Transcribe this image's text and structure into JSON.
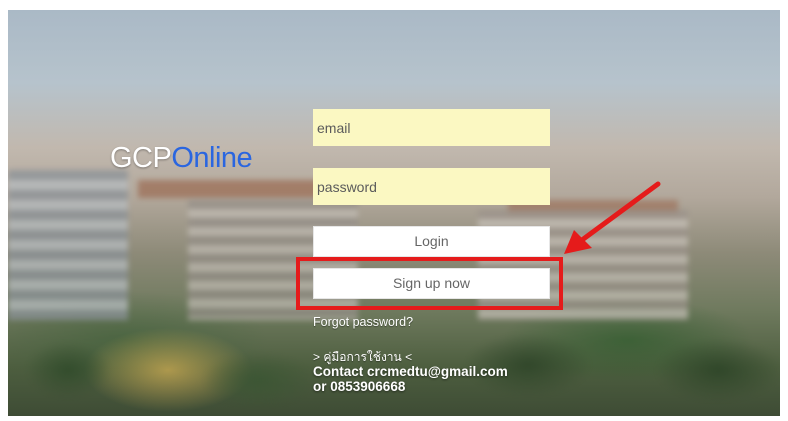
{
  "brand": {
    "part1": "GCP",
    "part2": "Online"
  },
  "login_form": {
    "email_placeholder": "email",
    "password_placeholder": "password",
    "login_label": "Login",
    "signup_label": "Sign up now",
    "forgot_label": "Forgot password?"
  },
  "footer": {
    "manual_link": "> คู่มือการใช้งาน <",
    "contact_line1": "Contact crcmedtu@gmail.com",
    "contact_line2": "or 0853906668"
  },
  "annotation": {
    "highlight_color": "#e51b1b",
    "arrow_icon": "red-arrow-icon"
  },
  "colors": {
    "brand_accent": "#2a66e0",
    "field_background": "#fbf8c2"
  }
}
